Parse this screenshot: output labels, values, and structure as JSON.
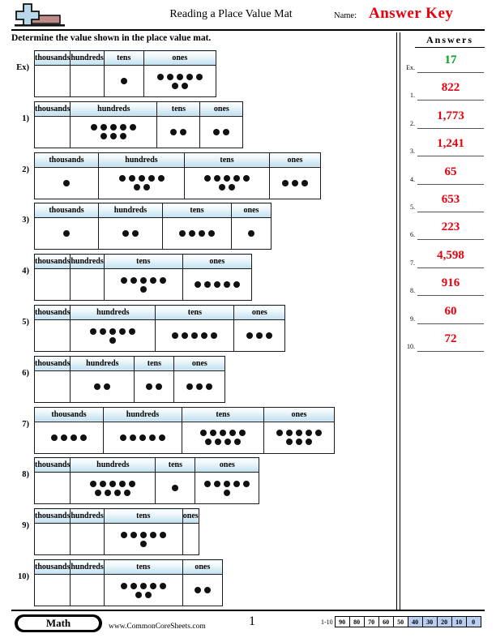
{
  "header": {
    "title": "Reading a Place Value Mat",
    "name_label": "Name:",
    "name_value": "Answer Key",
    "logo_icon": "plus-block-logo"
  },
  "instructions": "Determine the value shown in the place value mat.",
  "answers_panel": {
    "title": "Answers",
    "rows": [
      {
        "num": "Ex.",
        "value": "17",
        "color": "#00a11e"
      },
      {
        "num": "1.",
        "value": "822",
        "color": "#e8000d"
      },
      {
        "num": "2.",
        "value": "1,773",
        "color": "#e8000d"
      },
      {
        "num": "3.",
        "value": "1,241",
        "color": "#e8000d"
      },
      {
        "num": "4.",
        "value": "65",
        "color": "#e8000d"
      },
      {
        "num": "5.",
        "value": "653",
        "color": "#e8000d"
      },
      {
        "num": "6.",
        "value": "223",
        "color": "#e8000d"
      },
      {
        "num": "7.",
        "value": "4,598",
        "color": "#e8000d"
      },
      {
        "num": "8.",
        "value": "916",
        "color": "#e8000d"
      },
      {
        "num": "9.",
        "value": "60",
        "color": "#e8000d"
      },
      {
        "num": "10.",
        "value": "72",
        "color": "#e8000d"
      }
    ]
  },
  "column_headers": [
    "thousands",
    "hundreds",
    "tens",
    "ones"
  ],
  "problems": [
    {
      "label": "Ex)",
      "widths": [
        85,
        85,
        48,
        88
      ],
      "counts": [
        0,
        0,
        1,
        7
      ],
      "answer": "17"
    },
    {
      "label": "1)",
      "widths": [
        78,
        106,
        52,
        52
      ],
      "counts": [
        0,
        8,
        2,
        2
      ],
      "answer": "822"
    },
    {
      "label": "2)",
      "widths": [
        78,
        105,
        104,
        62
      ],
      "counts": [
        1,
        7,
        7,
        3
      ],
      "answer": "1,773"
    },
    {
      "label": "3)",
      "widths": [
        78,
        78,
        84,
        48
      ],
      "counts": [
        1,
        2,
        4,
        1
      ],
      "answer": "1,241"
    },
    {
      "label": "4)",
      "widths": [
        78,
        78,
        96,
        84
      ],
      "counts": [
        0,
        0,
        6,
        5
      ],
      "answer": "65"
    },
    {
      "label": "5)",
      "widths": [
        78,
        104,
        96,
        62
      ],
      "counts": [
        0,
        6,
        5,
        3
      ],
      "answer": "653"
    },
    {
      "label": "6)",
      "widths": [
        78,
        78,
        48,
        62
      ],
      "counts": [
        0,
        2,
        2,
        3
      ],
      "answer": "223"
    },
    {
      "label": "7)",
      "widths": [
        84,
        96,
        100,
        86
      ],
      "counts": [
        4,
        5,
        9,
        8
      ],
      "answer": "4,598"
    },
    {
      "label": "8)",
      "widths": [
        78,
        104,
        48,
        78
      ],
      "counts": [
        0,
        9,
        1,
        6
      ],
      "answer": "916"
    },
    {
      "label": "9)",
      "widths": [
        78,
        78,
        96,
        48
      ],
      "counts": [
        0,
        0,
        6,
        0
      ],
      "answer": "60"
    },
    {
      "label": "10)",
      "widths": [
        78,
        78,
        96,
        48
      ],
      "counts": [
        0,
        0,
        7,
        2
      ],
      "answer": "72"
    }
  ],
  "footer": {
    "subject": "Math",
    "site": "www.CommonCoreSheets.com",
    "page_number": "1",
    "scale_label": "1-10",
    "scale_values": [
      "90",
      "80",
      "70",
      "60",
      "50",
      "40",
      "30",
      "20",
      "10",
      "0"
    ],
    "scale_shaded_from": "40",
    "scale_shade_color": "#b8cdf0"
  }
}
